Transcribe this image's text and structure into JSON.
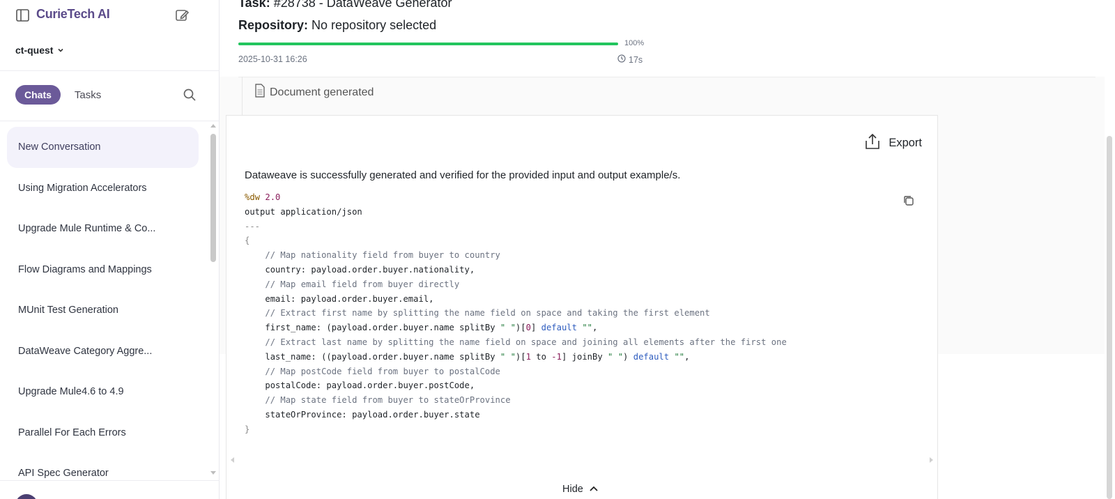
{
  "sidebar": {
    "brand": "CurieTech AI",
    "workspace": "ct-quest",
    "tabs": {
      "chats": "Chats",
      "tasks": "Tasks"
    },
    "conversations": [
      "New Conversation",
      "Using Migration Accelerators",
      "Upgrade Mule Runtime & Co...",
      "Flow Diagrams and Mappings",
      "MUnit Test Generation",
      "DataWeave Category Aggre...",
      "Upgrade Mule4.6 to 4.9",
      "Parallel For Each Errors",
      "API Spec Generator"
    ]
  },
  "header": {
    "task_label": "Task:",
    "task_value": "#28738 - DataWeave Generator",
    "repo_label": "Repository:",
    "repo_value": "No repository selected",
    "progress_percent": "100%",
    "progress_value": 1.0,
    "timestamp": "2025-10-31 16:26",
    "duration": "17s"
  },
  "document": {
    "label": "Document generated",
    "export_label": "Export",
    "summary": "Dataweave is successfully generated and verified for the provided input and output example/s.",
    "hide_label": "Hide"
  },
  "code": {
    "line1_pct": "%dw",
    "line1_ver": "2.0",
    "line2": "output application/json",
    "line3": "---",
    "line4": "{",
    "c1": "// Map nationality field from buyer to country",
    "l1": "country: payload.order.buyer.nationality,",
    "c2": "// Map email field from buyer directly",
    "l2": "email: payload.order.buyer.email,",
    "c3": "// Extract first name by splitting the name field on space and taking the first element",
    "l3a": "first_name: (payload.order.buyer.name splitBy ",
    "l3str": "\" \"",
    "l3b": ")[",
    "l3num": "0",
    "l3c": "] ",
    "l3kw": "default",
    "l3d": " ",
    "l3str2": "\"\"",
    "l3e": ",",
    "c4": "// Extract last name by splitting the name field on space and joining all elements after the first one",
    "l4a": "last_name: ((payload.order.buyer.name splitBy ",
    "l4str": "\" \"",
    "l4b": ")[",
    "l4n1": "1",
    "l4to": " to ",
    "l4n2": "-1",
    "l4c": "] joinBy ",
    "l4str2": "\" \"",
    "l4d": ") ",
    "l4kw": "default",
    "l4e": " ",
    "l4str3": "\"\"",
    "l4f": ",",
    "c5": "// Map postCode field from buyer to postalCode",
    "l5": "postalCode: payload.order.buyer.postCode,",
    "c6": "// Map state field from buyer to stateOrProvince",
    "l6": "stateOrProvince: payload.order.buyer.state",
    "last": "}"
  },
  "colors": {
    "accent": "#6b5a99",
    "progress": "#22c55e"
  }
}
